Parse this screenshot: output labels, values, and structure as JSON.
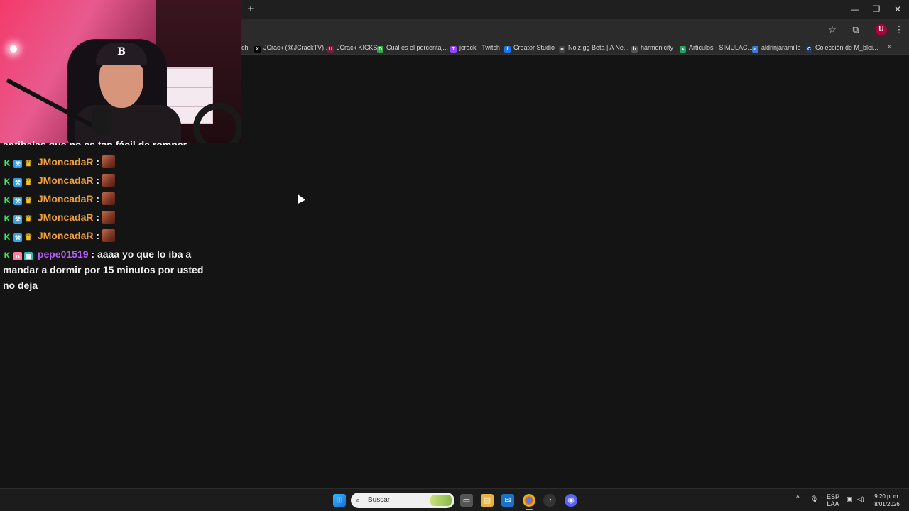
{
  "browser": {
    "new_tab_glyph": "+",
    "window_controls": {
      "minimize": "—",
      "restore": "❐",
      "close": "✕"
    },
    "toolbar": {
      "star_icon": "☆",
      "extensions_icon": "⧉",
      "profile_label": "U",
      "menu_icon": "⋮"
    },
    "bookmarks": [
      {
        "label": "ch",
        "fav": "",
        "color": "#2b2b2b"
      },
      {
        "label": "JCrack (@JCrackTV)...",
        "fav": "X",
        "color": "#000000"
      },
      {
        "label": "JCrack KICKS",
        "fav": "U",
        "color": "#7a1b3a"
      },
      {
        "label": "Cuál es el porcentaj...",
        "fav": "D",
        "color": "#3fa34d"
      },
      {
        "label": "jcrack - Twitch",
        "fav": "T",
        "color": "#9146ff"
      },
      {
        "label": "Creator Studio",
        "fav": "f",
        "color": "#1877f2"
      },
      {
        "label": "Noiz.gg Beta | A Ne...",
        "fav": "o",
        "color": "#444444"
      },
      {
        "label": "harmonicity",
        "fav": "h",
        "color": "#555555"
      },
      {
        "label": "Articulos - SIMULAC...",
        "fav": "▲",
        "color": "#1fa463"
      },
      {
        "label": "aldrinjaramillo",
        "fav": "a",
        "color": "#3a7bd5"
      },
      {
        "label": "Colección de M_blei...",
        "fav": "C",
        "color": "#1d3a5f"
      }
    ],
    "bookmarks_more": "»"
  },
  "chat": {
    "cut_line": "antibalas que no es tan fácil de romper",
    "messages": [
      {
        "user": "JMoncadaR",
        "text": ""
      },
      {
        "user": "JMoncadaR",
        "text": ""
      },
      {
        "user": "JMoncadaR",
        "text": ""
      },
      {
        "user": "JMoncadaR",
        "text": ""
      },
      {
        "user": "JMoncadaR",
        "text": ""
      }
    ],
    "last": {
      "user": "pepe01519",
      "line1": ": aaaa yo que lo iba a",
      "line2": "mandar a dormir por 15 minutos por usted",
      "line3": "no deja"
    },
    "separator": ":"
  },
  "webcam": {
    "cap_letter": "B"
  },
  "taskbar": {
    "search_placeholder": "Buscar",
    "search_icon": "⌕",
    "tray_chevron": "^",
    "mic_icon": "🎙",
    "lang_line1": "ESP",
    "lang_line2": "LAA",
    "time": "9:20 p. m.",
    "date": "8/01/2026"
  }
}
